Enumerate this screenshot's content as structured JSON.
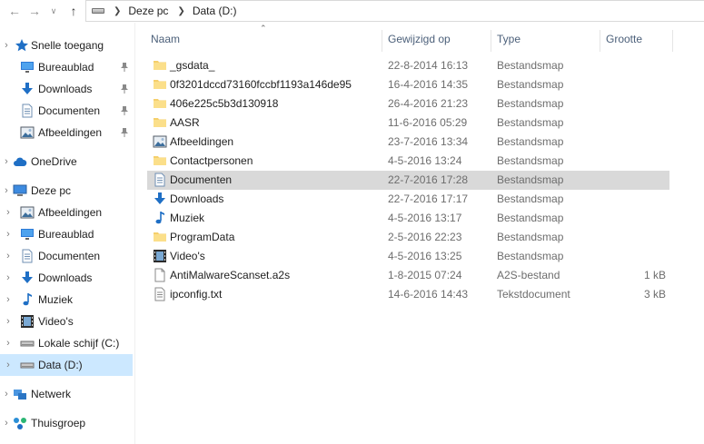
{
  "address": {
    "crumbs": [
      "Deze pc",
      "Data (D:)"
    ]
  },
  "sidebar": {
    "quick_access": "Snelle toegang",
    "quick_items": [
      {
        "label": "Bureaublad",
        "icon": "desktop-icon"
      },
      {
        "label": "Downloads",
        "icon": "download-icon"
      },
      {
        "label": "Documenten",
        "icon": "document-icon"
      },
      {
        "label": "Afbeeldingen",
        "icon": "picture-icon"
      }
    ],
    "onedrive": "OneDrive",
    "this_pc": "Deze pc",
    "pc_items": [
      {
        "label": "Afbeeldingen",
        "icon": "picture-icon"
      },
      {
        "label": "Bureaublad",
        "icon": "desktop-icon"
      },
      {
        "label": "Documenten",
        "icon": "document-icon"
      },
      {
        "label": "Downloads",
        "icon": "download-icon"
      },
      {
        "label": "Muziek",
        "icon": "music-icon"
      },
      {
        "label": "Video's",
        "icon": "video-icon"
      },
      {
        "label": "Lokale schijf (C:)",
        "icon": "drive-icon"
      },
      {
        "label": "Data (D:)",
        "icon": "drive-icon",
        "selected": true
      }
    ],
    "network": "Netwerk",
    "homegroup": "Thuisgroep"
  },
  "columns": {
    "name": "Naam",
    "modified": "Gewijzigd op",
    "type": "Type",
    "size": "Grootte"
  },
  "files": [
    {
      "name": "_gsdata_",
      "modified": "22-8-2014 16:13",
      "type": "Bestandsmap",
      "size": "",
      "icon": "folder-icon"
    },
    {
      "name": "0f3201dccd73160fccbf1193a146de95",
      "modified": "16-4-2016 14:35",
      "type": "Bestandsmap",
      "size": "",
      "icon": "folder-icon"
    },
    {
      "name": "406e225c5b3d130918",
      "modified": "26-4-2016 21:23",
      "type": "Bestandsmap",
      "size": "",
      "icon": "folder-icon"
    },
    {
      "name": "AASR",
      "modified": "11-6-2016 05:29",
      "type": "Bestandsmap",
      "size": "",
      "icon": "folder-icon"
    },
    {
      "name": "Afbeeldingen",
      "modified": "23-7-2016 13:34",
      "type": "Bestandsmap",
      "size": "",
      "icon": "picture-icon"
    },
    {
      "name": "Contactpersonen",
      "modified": "4-5-2016 13:24",
      "type": "Bestandsmap",
      "size": "",
      "icon": "folder-icon"
    },
    {
      "name": "Documenten",
      "modified": "22-7-2016 17:28",
      "type": "Bestandsmap",
      "size": "",
      "icon": "document-icon",
      "selected": true
    },
    {
      "name": "Downloads",
      "modified": "22-7-2016 17:17",
      "type": "Bestandsmap",
      "size": "",
      "icon": "download-icon"
    },
    {
      "name": "Muziek",
      "modified": "4-5-2016 13:17",
      "type": "Bestandsmap",
      "size": "",
      "icon": "music-icon"
    },
    {
      "name": "ProgramData",
      "modified": "2-5-2016 22:23",
      "type": "Bestandsmap",
      "size": "",
      "icon": "folder-icon"
    },
    {
      "name": "Video's",
      "modified": "4-5-2016 13:25",
      "type": "Bestandsmap",
      "size": "",
      "icon": "video-icon"
    },
    {
      "name": "AntiMalwareScanset.a2s",
      "modified": "1-8-2015 07:24",
      "type": "A2S-bestand",
      "size": "1 kB",
      "icon": "file-icon"
    },
    {
      "name": "ipconfig.txt",
      "modified": "14-6-2016 14:43",
      "type": "Tekstdocument",
      "size": "3 kB",
      "icon": "text-file-icon"
    }
  ]
}
